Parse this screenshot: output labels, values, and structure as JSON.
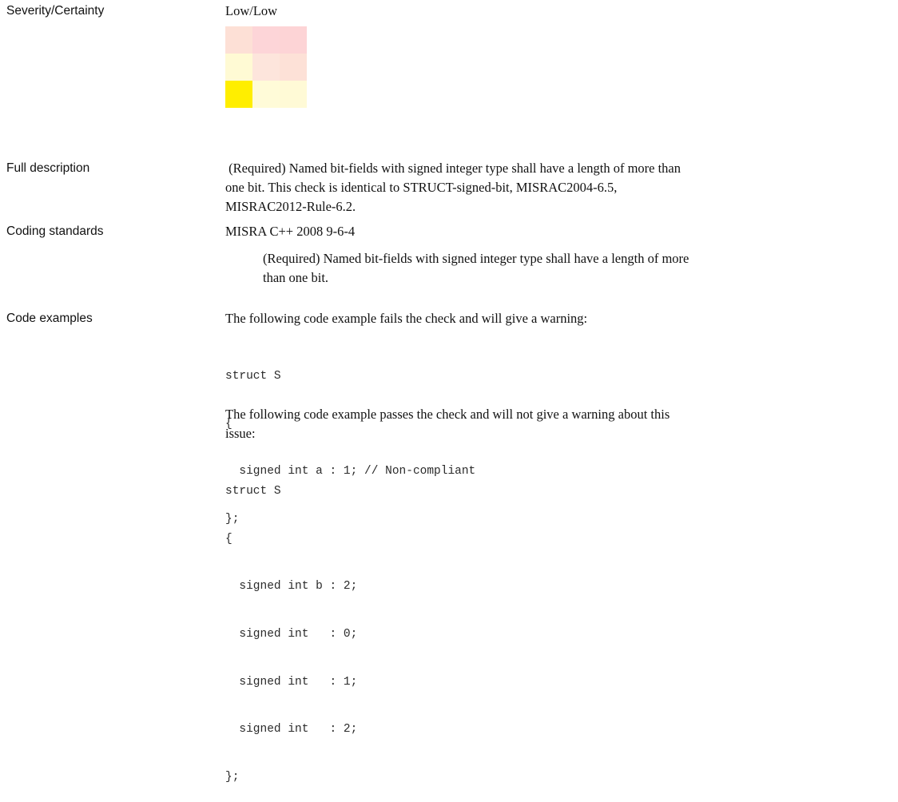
{
  "severity": {
    "label": "Severity/Certainty",
    "value": "Low/Low",
    "matrix_colors": [
      [
        "#fde0d6",
        "#fdd5d8",
        "#fdd4d6"
      ],
      [
        "#fffad4",
        "#fde5dc",
        "#fde1d7"
      ],
      [
        "#ffee00",
        "#fffbd8",
        "#fffad6"
      ]
    ]
  },
  "full_description": {
    "label": "Full description",
    "lines": [
      " (Required) Named bit-fields with signed integer type shall have a length of more than",
      "one bit. This check is identical to STRUCT-signed-bit, MISRAC2004-6.5,",
      "MISRAC2012-Rule-6.2."
    ]
  },
  "coding_standards": {
    "label": "Coding standards",
    "standard": "MISRA C++ 2008 9-6-4",
    "description_lines": [
      "(Required) Named bit-fields with signed integer type shall have a length of more",
      "than one bit."
    ]
  },
  "code_examples": {
    "label": "Code examples",
    "fail_intro": "The following code example fails the check and will give a warning:",
    "fail_code": [
      "struct S",
      "{",
      "  signed int a : 1; // Non-compliant",
      "};"
    ],
    "pass_intro_lines": [
      "The following code example passes the check and will not give a warning about this",
      "issue:"
    ],
    "pass_code": [
      "struct S",
      "{",
      "  signed int b : 2;",
      "  signed int   : 0;",
      "  signed int   : 1;",
      "  signed int   : 2;",
      "};"
    ]
  }
}
